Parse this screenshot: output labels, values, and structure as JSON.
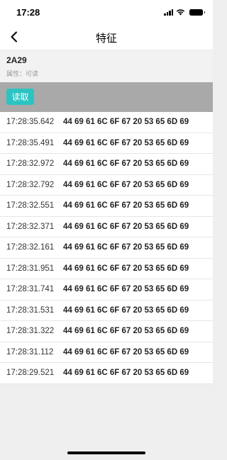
{
  "status_bar": {
    "time": "17:28",
    "icons": [
      "signal-icon",
      "wifi-icon",
      "battery-icon"
    ]
  },
  "nav": {
    "title": "特征",
    "back_icon": "chevron-left-icon"
  },
  "characteristic": {
    "uuid": "2A29",
    "property": "属性：可读"
  },
  "actions": {
    "read_label": "读取",
    "read_color": "#2bc4c2"
  },
  "log": [
    {
      "time": "17:28:35.642",
      "value": "44 69 61 6C 6F 67 20 53 65 6D 69"
    },
    {
      "time": "17:28:35.491",
      "value": "44 69 61 6C 6F 67 20 53 65 6D 69"
    },
    {
      "time": "17:28:32.972",
      "value": "44 69 61 6C 6F 67 20 53 65 6D 69"
    },
    {
      "time": "17:28:32.792",
      "value": "44 69 61 6C 6F 67 20 53 65 6D 69"
    },
    {
      "time": "17:28:32.551",
      "value": "44 69 61 6C 6F 67 20 53 65 6D 69"
    },
    {
      "time": "17:28:32.371",
      "value": "44 69 61 6C 6F 67 20 53 65 6D 69"
    },
    {
      "time": "17:28:32.161",
      "value": "44 69 61 6C 6F 67 20 53 65 6D 69"
    },
    {
      "time": "17:28:31.951",
      "value": "44 69 61 6C 6F 67 20 53 65 6D 69"
    },
    {
      "time": "17:28:31.741",
      "value": "44 69 61 6C 6F 67 20 53 65 6D 69"
    },
    {
      "time": "17:28:31.531",
      "value": "44 69 61 6C 6F 67 20 53 65 6D 69"
    },
    {
      "time": "17:28:31.322",
      "value": "44 69 61 6C 6F 67 20 53 65 6D 69"
    },
    {
      "time": "17:28:31.112",
      "value": "44 69 61 6C 6F 67 20 53 65 6D 69"
    },
    {
      "time": "17:28:29.521",
      "value": "44 69 61 6C 6F 67 20 53 65 6D 69"
    }
  ]
}
